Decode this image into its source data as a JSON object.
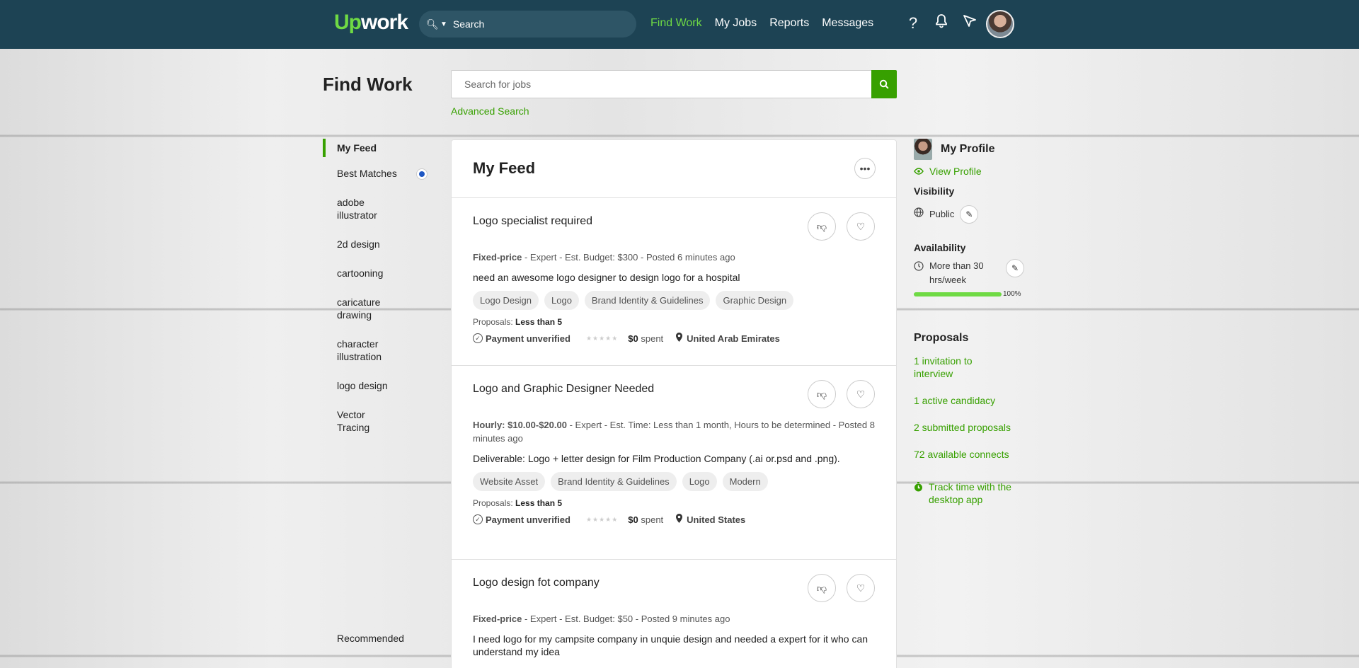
{
  "header": {
    "logo_up": "Up",
    "logo_rest": "work",
    "search_placeholder": "Search",
    "nav": [
      "Find Work",
      "My Jobs",
      "Reports",
      "Messages"
    ]
  },
  "page": {
    "title": "Find Work",
    "search_placeholder": "Search for jobs",
    "advanced_search": "Advanced Search"
  },
  "sidebar": {
    "items": [
      "My Feed",
      "Best Matches",
      "adobe illustrator",
      "2d design",
      "cartooning",
      "caricature drawing",
      "character illustration",
      "logo design",
      "Vector Tracing"
    ],
    "recommended": "Recommended"
  },
  "feed": {
    "title": "My Feed",
    "jobs": [
      {
        "title": "Logo specialist required",
        "type": "Fixed-price",
        "meta": " - Expert - Est. Budget: $300 - Posted 6 minutes ago",
        "desc": "need an awesome logo designer to design logo for a hospital",
        "tags": [
          "Logo Design",
          "Logo",
          "Brand Identity & Guidelines",
          "Graphic Design"
        ],
        "proposals_label": "Proposals: ",
        "proposals": "Less than 5",
        "payment": "Payment unverified",
        "spent_amount": "$0",
        "spent_label": " spent",
        "location": "United Arab Emirates"
      },
      {
        "title": "Logo and Graphic Designer Needed",
        "type": "Hourly: $10.00-$20.00",
        "meta": " - Expert - Est. Time: Less than 1 month, Hours to be determined - Posted 8 minutes ago",
        "desc": "Deliverable: Logo + letter design for Film Production Company (.ai or.psd and .png).",
        "tags": [
          "Website Asset",
          "Brand Identity & Guidelines",
          "Logo",
          "Modern"
        ],
        "proposals_label": "Proposals: ",
        "proposals": "Less than 5",
        "payment": "Payment unverified",
        "spent_amount": "$0",
        "spent_label": " spent",
        "location": "United States"
      },
      {
        "title": "Logo design fot company",
        "type": "Fixed-price",
        "meta": " - Expert - Est. Budget: $50 - Posted 9 minutes ago",
        "desc": "I need logo for my campsite company in unquie design and needed a expert for it who can understand my idea"
      }
    ]
  },
  "profile": {
    "title": "My Profile",
    "view_profile": "View Profile",
    "visibility_label": "Visibility",
    "visibility_value": "Public",
    "availability_label": "Availability",
    "availability_value": "More than 30 hrs/week",
    "availability_pct": "100%",
    "availability_fraction": 1.0,
    "proposals_label": "Proposals",
    "links": [
      "1 invitation to interview",
      "1 active candidacy",
      "2 submitted proposals",
      "72 available connects"
    ],
    "track_time": "Track time with the desktop app"
  },
  "colors": {
    "nav_bg": "#1d4354",
    "accent": "#37a000",
    "accent_light": "#6fda44"
  }
}
